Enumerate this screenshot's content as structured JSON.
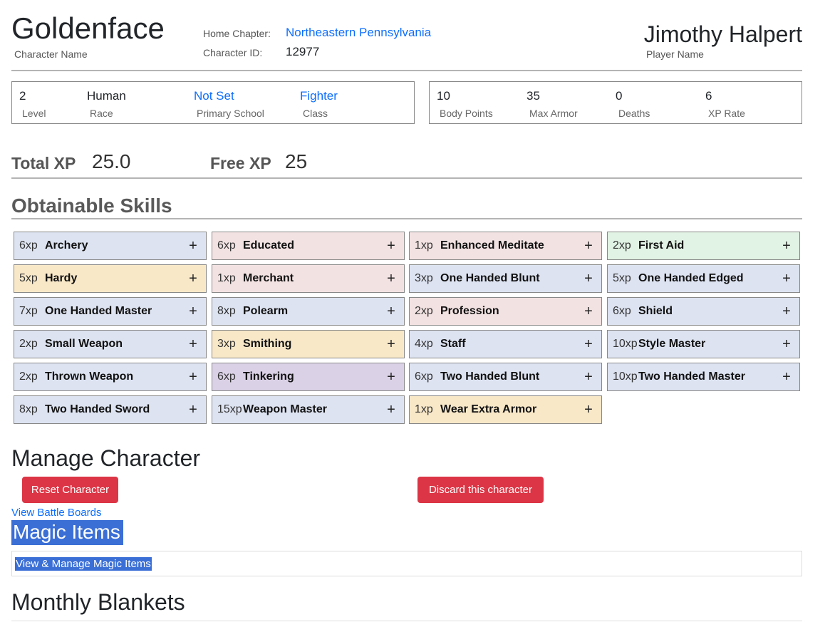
{
  "header": {
    "character_name": "Goldenface",
    "character_name_label": "Character Name",
    "home_chapter_label": "Home Chapter:",
    "home_chapter": "Northeastern Pennsylvania",
    "character_id_label": "Character ID:",
    "character_id": "12977",
    "player_name": "Jimothy Halpert",
    "player_name_label": "Player Name"
  },
  "stats_left": [
    {
      "value": "2",
      "label": "Level",
      "link": false
    },
    {
      "value": "Human",
      "label": "Race",
      "link": false
    },
    {
      "value": "Not Set",
      "label": "Primary School",
      "link": true
    },
    {
      "value": "Fighter",
      "label": "Class",
      "link": true
    }
  ],
  "stats_right": [
    {
      "value": "10",
      "label": "Body Points"
    },
    {
      "value": "35",
      "label": "Max Armor"
    },
    {
      "value": "0",
      "label": "Deaths"
    },
    {
      "value": "6",
      "label": "XP Rate"
    }
  ],
  "xp": {
    "total_label": "Total XP",
    "total_value": "25.0",
    "free_label": "Free XP",
    "free_value": "25"
  },
  "skills_title": "Obtainable Skills",
  "skill_colors": {
    "blue": "#dde3f1",
    "pink": "#f3e2e2",
    "green": "#e1f3e4",
    "yellow": "#f8e8c8",
    "purple": "#dad1e6"
  },
  "skills": [
    {
      "cost": "6xp",
      "name": "Archery",
      "color": "blue"
    },
    {
      "cost": "6xp",
      "name": "Educated",
      "color": "pink"
    },
    {
      "cost": "1xp",
      "name": "Enhanced Meditate",
      "color": "pink"
    },
    {
      "cost": "2xp",
      "name": "First Aid",
      "color": "green"
    },
    {
      "cost": "5xp",
      "name": "Hardy",
      "color": "yellow"
    },
    {
      "cost": "1xp",
      "name": "Merchant",
      "color": "pink"
    },
    {
      "cost": "3xp",
      "name": "One Handed Blunt",
      "color": "blue"
    },
    {
      "cost": "5xp",
      "name": "One Handed Edged",
      "color": "blue"
    },
    {
      "cost": "7xp",
      "name": "One Handed Master",
      "color": "blue"
    },
    {
      "cost": "8xp",
      "name": "Polearm",
      "color": "blue"
    },
    {
      "cost": "2xp",
      "name": "Profession",
      "color": "pink"
    },
    {
      "cost": "6xp",
      "name": "Shield",
      "color": "blue"
    },
    {
      "cost": "2xp",
      "name": "Small Weapon",
      "color": "blue"
    },
    {
      "cost": "3xp",
      "name": "Smithing",
      "color": "yellow"
    },
    {
      "cost": "4xp",
      "name": "Staff",
      "color": "blue"
    },
    {
      "cost": "10xp",
      "name": "Style Master",
      "color": "blue"
    },
    {
      "cost": "2xp",
      "name": "Thrown Weapon",
      "color": "blue"
    },
    {
      "cost": "6xp",
      "name": "Tinkering",
      "color": "purple"
    },
    {
      "cost": "6xp",
      "name": "Two Handed Blunt",
      "color": "blue"
    },
    {
      "cost": "10xp",
      "name": "Two Handed Master",
      "color": "blue"
    },
    {
      "cost": "8xp",
      "name": "Two Handed Sword",
      "color": "blue"
    },
    {
      "cost": "15xp",
      "name": "Weapon Master",
      "color": "blue"
    },
    {
      "cost": "1xp",
      "name": "Wear Extra Armor",
      "color": "yellow"
    }
  ],
  "skill_add_symbol": "+",
  "manage": {
    "title": "Manage Character",
    "reset_label": "Reset Character",
    "discard_label": "Discard this character",
    "battle_boards_link": "View Battle Boards",
    "button_color": "#dc3545"
  },
  "magic": {
    "title": "Magic Items",
    "link": "View & Manage Magic Items",
    "selection_color": "#3b6fd6"
  },
  "monthly_title": "Monthly Blankets"
}
